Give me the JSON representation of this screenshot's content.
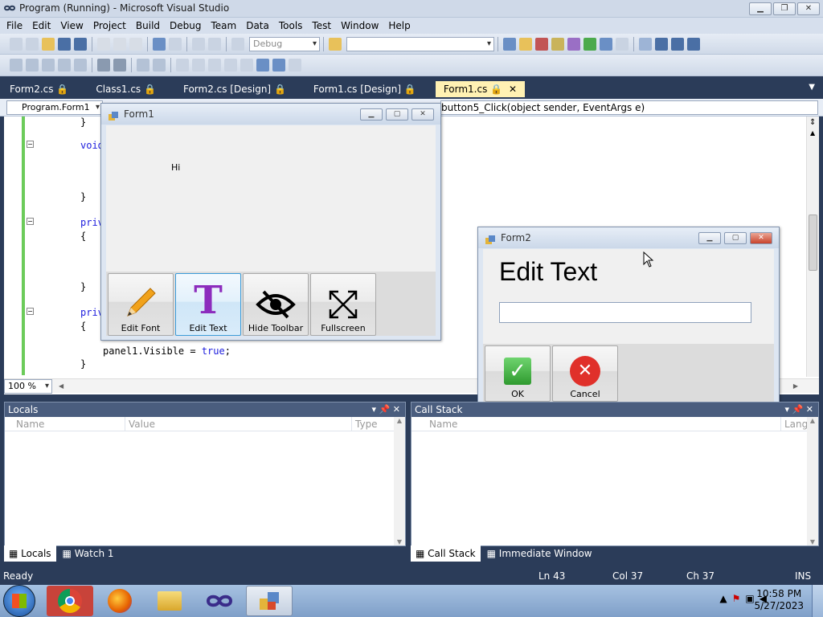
{
  "window": {
    "title": "Program (Running) - Microsoft Visual Studio"
  },
  "menu": [
    "File",
    "Edit",
    "View",
    "Project",
    "Build",
    "Debug",
    "Team",
    "Data",
    "Tools",
    "Test",
    "Window",
    "Help"
  ],
  "toolbar": {
    "config": "Debug",
    "search_combo": ""
  },
  "doc_tabs": [
    "Form2.cs",
    "Class1.cs",
    "Form2.cs [Design]",
    "Form1.cs [Design]",
    "Form1.cs"
  ],
  "nav": {
    "left": "Program.Form1",
    "right": "button5_Click(object sender, EventArgs e)"
  },
  "code": {
    "lines": [
      "}",
      "void",
      "}",
      "priv",
      "{",
      "}",
      "priv",
      "{",
      "panel1.Visible = true;",
      "}"
    ],
    "keyword_true": "true",
    "stmt": "panel1.Visible = ",
    "tail": ";"
  },
  "editor": {
    "zoom": "100 %"
  },
  "form1": {
    "title": "Form1",
    "label": "Hi",
    "buttons": [
      "Edit Font",
      "Edit Text",
      "Hide Toolbar",
      "Fullscreen"
    ]
  },
  "form2": {
    "title": "Form2",
    "heading": "Edit Text",
    "input_value": "",
    "ok": "OK",
    "cancel": "Cancel"
  },
  "locals": {
    "title": "Locals",
    "cols": [
      "Name",
      "Value",
      "Type"
    ],
    "tabs": [
      "Locals",
      "Watch 1"
    ]
  },
  "callstack": {
    "title": "Call Stack",
    "cols": [
      "Name",
      "Lang"
    ],
    "tabs": [
      "Call Stack",
      "Immediate Window"
    ]
  },
  "status": {
    "text": "Ready",
    "ln": "Ln 43",
    "col": "Col 37",
    "ch": "Ch 37",
    "mode": "INS"
  },
  "clock": {
    "time": "10:58 PM",
    "date": "5/27/2023"
  },
  "colors": {
    "vs_dark": "#2b3c59",
    "tab_active": "#fff1b3",
    "ok_green": "#3fae3f",
    "cancel_red": "#e0302a",
    "edit_purple": "#8c2cbd"
  }
}
